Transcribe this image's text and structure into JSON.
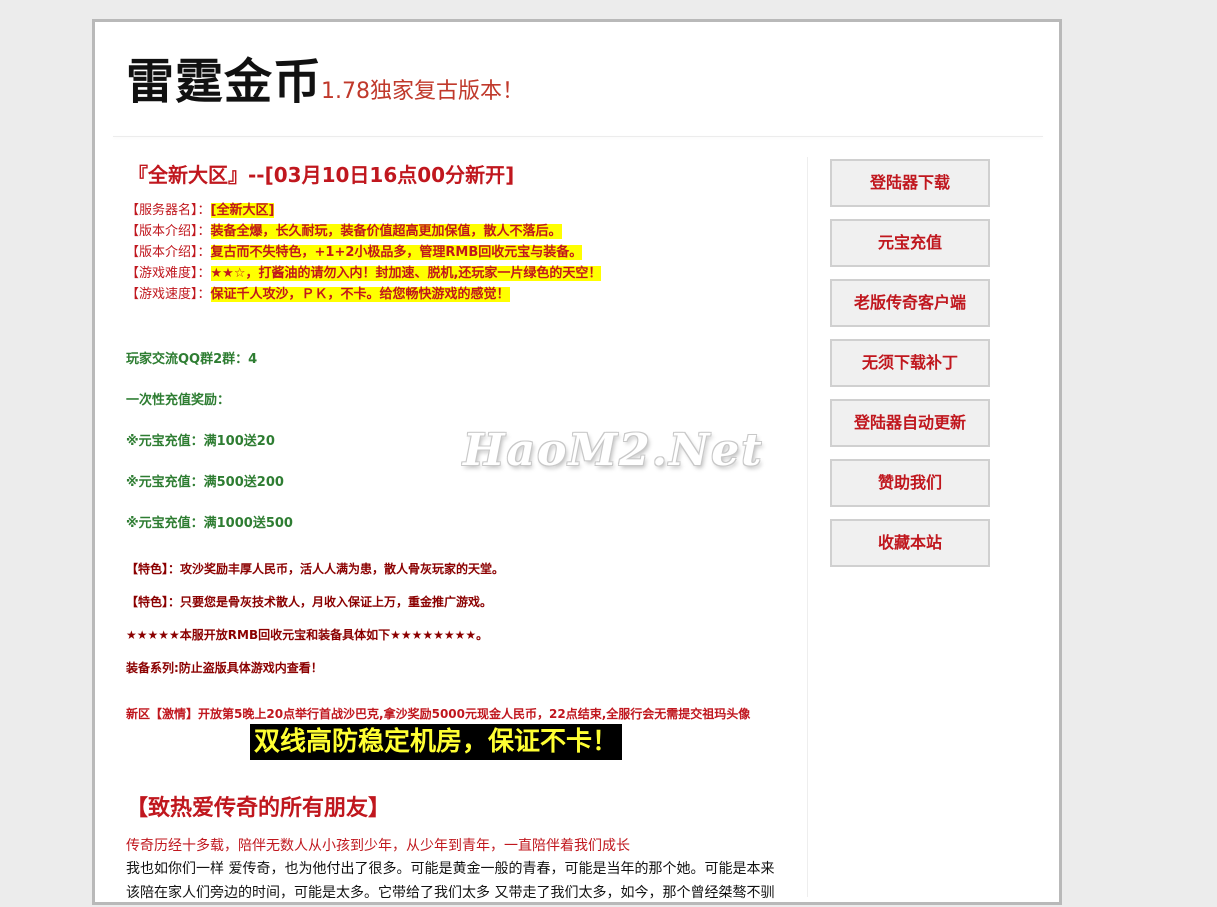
{
  "header": {
    "site_name": "雷霆金币",
    "slogan": "1.78独家复古版本！"
  },
  "main": {
    "section_title": "『全新大区』--[03月10日16点00分新开]",
    "info_rows": [
      {
        "label": "【服务器名】：",
        "value": "[全新大区]"
      },
      {
        "label": "【版本介绍】：",
        "value": "装备全爆，长久耐玩，装备价值超高更加保值，散人不落后。"
      },
      {
        "label": "【版本介绍】：",
        "value": "复古而不失特色，+1+2小极品多，管理RMB回收元宝与装备。"
      },
      {
        "label": "【游戏难度】：",
        "value_stars": "★★☆",
        "value": "，打酱油的请勿入内！封加速、脱机,还玩家一片绿色的天空！"
      },
      {
        "label": "【游戏速度】：",
        "value": "保证千人攻沙，ＰＫ，不卡。给您畅快游戏的感觉！"
      }
    ],
    "qq_group": "玩家交流QQ群2群：4",
    "recharge_title": "一次性充值奖励：",
    "recharge_items": [
      "※元宝充值：满100送20",
      "※元宝充值：满500送200",
      "※元宝充值：满1000送500"
    ],
    "features": [
      "【特色】：攻沙奖励丰厚人民币，活人人满为患，散人骨灰玩家的天堂。",
      "【特色】：只要您是骨灰技术散人，月收入保证上万，重金推广游戏。",
      "★★★★★本服开放RMB回收元宝和装备具体如下★★★★★★★★。",
      "装备系列:防止盗版具体游戏内查看！"
    ],
    "new_zone_notice": "新区【激情】开放第5晚上20点举行首战沙巴克,拿沙奖励5000元现金人民币，22点结束,全服行会无需提交祖玛头像",
    "banner": "双线高防稳定机房，保证不卡！",
    "friends_title": "【致热爱传奇的所有朋友】",
    "intro_red": "传奇历经十多载，陪伴无数人从小孩到少年，从少年到青年，一直陪伴着我们成长",
    "intro_black": "我也如你们一样 爱传奇，也为他付出了很多。可能是黄金一般的青春，可能是当年的那个她。可能是本来该陪在家人们旁边的时间，可能是太多。它带给了我们太多 又带走了我们太多，如今，那个曾经桀骜不驯",
    "watermark": "HaoM2.Net"
  },
  "sidebar": {
    "buttons": [
      "登陆器下载",
      "元宝充值",
      "老版传奇客户端",
      "无须下载补丁",
      "登陆器自动更新",
      "赞助我们",
      "收藏本站"
    ]
  },
  "colors": {
    "accent_red": "#c0171e",
    "highlight_yellow": "#ffff00",
    "green_text": "#2e7d32",
    "banner_bg": "#000000",
    "banner_text": "#ffff33"
  }
}
